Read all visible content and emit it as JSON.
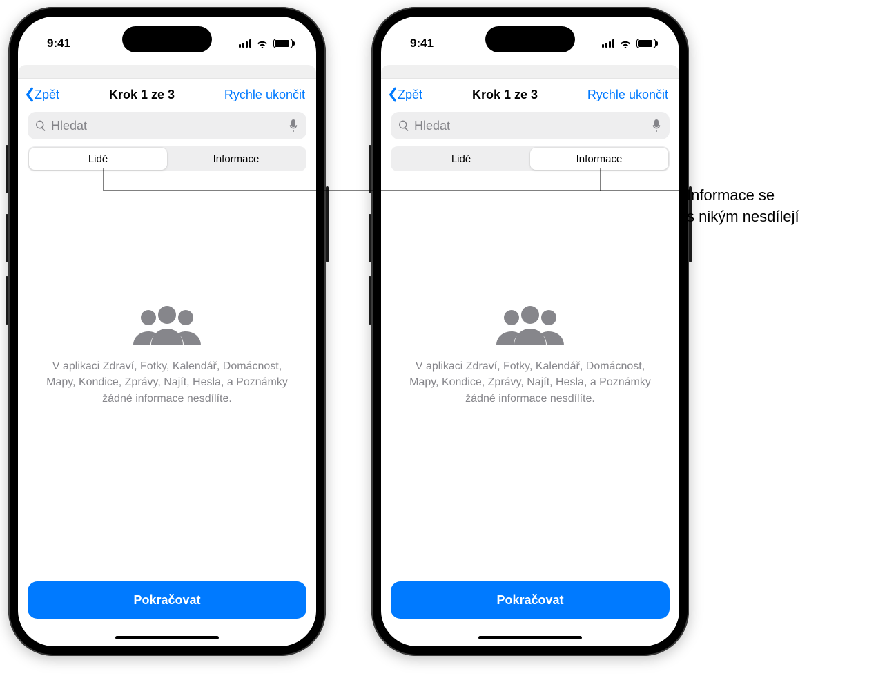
{
  "status": {
    "time": "9:41"
  },
  "nav": {
    "back": "Zpět",
    "title": "Krok 1 ze 3",
    "action": "Rychle ukončit"
  },
  "search": {
    "placeholder": "Hledat"
  },
  "segments": {
    "people": "Lidé",
    "info": "Informace"
  },
  "empty": {
    "text": "V aplikaci Zdraví, Fotky, Kalendář, Domácnost, Mapy, Kondice, Zprávy, Najít, Hesla, a Poznámky žádné informace nesdílíte."
  },
  "cta": "Pokračovat",
  "callout": {
    "line1": "Informace se",
    "line2": "s nikým nesdílejí"
  },
  "phones": [
    {
      "active_segment": "people"
    },
    {
      "active_segment": "info"
    }
  ]
}
